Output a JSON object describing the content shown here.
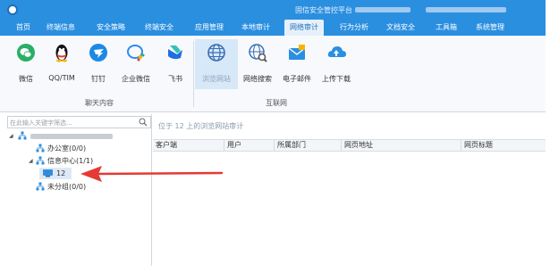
{
  "titlebar": {
    "title": "固信安全管控平台 - "
  },
  "menu": {
    "items": [
      {
        "label": "首页"
      },
      {
        "label": "终端信息"
      },
      {
        "label": "安全策略"
      },
      {
        "label": "终端安全"
      },
      {
        "label": "应用管理"
      },
      {
        "label": "本地审计"
      },
      {
        "label": "网络审计"
      },
      {
        "label": "行为分析"
      },
      {
        "label": "文档安全"
      },
      {
        "label": "工具箱"
      },
      {
        "label": "系统管理"
      }
    ],
    "active_index": 6
  },
  "ribbon": {
    "chat_group": {
      "label": "聊天内容",
      "buttons": [
        {
          "label": "微信",
          "icon": "wechat-icon",
          "color": "#2aae67"
        },
        {
          "label": "QQ/TIM",
          "icon": "qq-penguin-icon",
          "color": "#111111"
        },
        {
          "label": "钉钉",
          "icon": "dingtalk-icon",
          "color": "#1e88e5"
        },
        {
          "label": "企业微信",
          "icon": "wecom-icon",
          "color": "#2d8cf0"
        },
        {
          "label": "飞书",
          "icon": "feishu-icon",
          "color": "#1f6fe0"
        }
      ]
    },
    "internet_group": {
      "label": "互联网",
      "buttons": [
        {
          "label": "浏览网站",
          "icon": "globe-icon",
          "color": "#3a6fb5",
          "selected": true
        },
        {
          "label": "网络搜索",
          "icon": "web-search-icon",
          "color": "#3a6fb5"
        },
        {
          "label": "电子邮件",
          "icon": "email-icon",
          "color": "#2b8fe0"
        },
        {
          "label": "上传下载",
          "icon": "cloud-upload-icon",
          "color": "#2b8fe0"
        }
      ]
    }
  },
  "search": {
    "placeholder": "在此输入关键字筛选..."
  },
  "tree": {
    "items": [
      {
        "label": "办公室(0/0)",
        "icon": "org-icon"
      },
      {
        "label": "信息中心(1/1)",
        "icon": "org-icon"
      },
      {
        "label": "12",
        "icon": "computer-icon"
      },
      {
        "label": "未分组(0/0)",
        "icon": "org-icon"
      }
    ]
  },
  "main": {
    "context_label": "位于 12 上的浏览网站审计",
    "columns": [
      {
        "label": "客户端"
      },
      {
        "label": "用户"
      },
      {
        "label": "所属部门"
      },
      {
        "label": "网页地址"
      },
      {
        "label": "网页标题"
      }
    ]
  },
  "colors": {
    "accent": "#2b8fe0",
    "annotation_arrow": "#e53935"
  }
}
